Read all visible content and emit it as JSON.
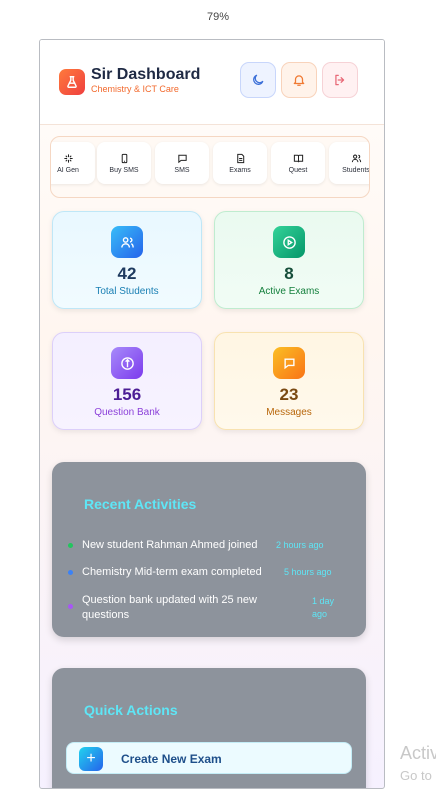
{
  "browser": {
    "zoom": "79%"
  },
  "header": {
    "title": "Sir Dashboard",
    "subtitle": "Chemistry & ICT Care",
    "logo_icon": "flask-icon",
    "buttons": [
      {
        "name": "theme-toggle",
        "icon": "moon-icon"
      },
      {
        "name": "notifications",
        "icon": "bell-icon"
      },
      {
        "name": "logout",
        "icon": "logout-icon"
      }
    ]
  },
  "quickbar": {
    "items": [
      {
        "label": "AI Gen",
        "icon": "sparkle-icon"
      },
      {
        "label": "Buy SMS",
        "icon": "phone-icon"
      },
      {
        "label": "SMS",
        "icon": "message-icon"
      },
      {
        "label": "Exams",
        "icon": "document-icon"
      },
      {
        "label": "Quest",
        "icon": "book-icon"
      },
      {
        "label": "Students",
        "icon": "users-icon"
      }
    ]
  },
  "stats": [
    {
      "value": "42",
      "label": "Total Students",
      "icon": "users-icon"
    },
    {
      "value": "8",
      "label": "Active Exams",
      "icon": "play-circle-icon"
    },
    {
      "value": "156",
      "label": "Question Bank",
      "icon": "compass-icon"
    },
    {
      "value": "23",
      "label": "Messages",
      "icon": "chat-icon"
    }
  ],
  "activities": {
    "title": "Recent Activities",
    "items": [
      {
        "text": "New student Rahman Ahmed joined",
        "time": "2 hours ago",
        "dot_color": "#22c55e"
      },
      {
        "text": "Chemistry Mid-term exam completed",
        "time": "5 hours ago",
        "dot_color": "#3b82f6"
      },
      {
        "text": "Question bank updated with 25 new questions",
        "time": "1 day ago",
        "dot_color": "#a855f7"
      }
    ]
  },
  "quick_actions": {
    "title": "Quick Actions",
    "create_exam_label": "Create New Exam"
  },
  "os_watermark": {
    "line1": "Activ",
    "line2": "Go to"
  }
}
